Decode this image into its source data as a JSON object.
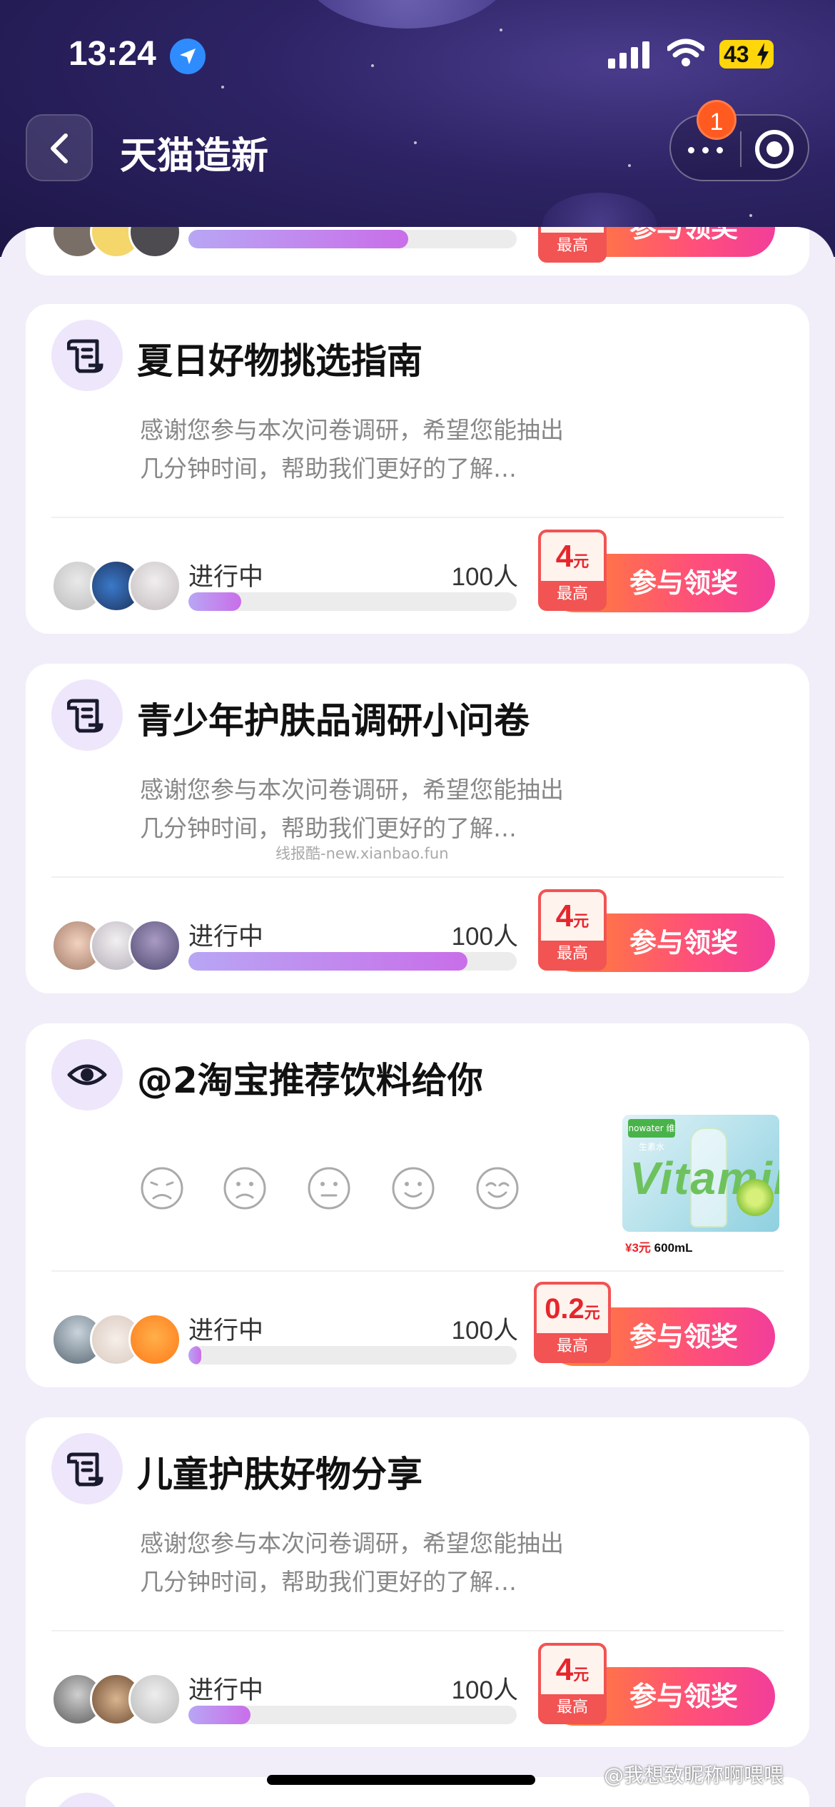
{
  "status_bar": {
    "time": "13:24",
    "battery": "43"
  },
  "nav": {
    "title": "天猫造新",
    "badge_count": "1"
  },
  "cards": [
    {
      "title": "夏日好物挑选指南",
      "desc": "感谢您参与本次问卷调研，希望您能抽出几分钟时间，帮助我们更好的了解…",
      "status": "进行中",
      "count": "100人",
      "progress": 0.16,
      "reward_amount": "4",
      "reward_unit": "元",
      "reward_label": "最高",
      "cta": "参与领奖",
      "icon": "scroll-icon"
    },
    {
      "title": "青少年护肤品调研小问卷",
      "desc": "感谢您参与本次问卷调研，希望您能抽出几分钟时间，帮助我们更好的了解…",
      "status": "进行中",
      "count": "100人",
      "progress": 0.85,
      "reward_amount": "4",
      "reward_unit": "元",
      "reward_label": "最高",
      "cta": "参与领奖",
      "icon": "scroll-icon"
    },
    {
      "title": "@2淘宝推荐饮料给你",
      "status": "进行中",
      "count": "100人",
      "progress": 0.04,
      "reward_amount": "0.2",
      "reward_unit": "元",
      "reward_label": "最高",
      "cta": "参与领奖",
      "icon": "eye-icon",
      "product": {
        "brand": "nowater 维生素水",
        "art_text": "Vitamin",
        "price": "¥3元",
        "volume": "600mL"
      }
    },
    {
      "title": "儿童护肤好物分享",
      "desc": "感谢您参与本次问卷调研，希望您能抽出几分钟时间，帮助我们更好的了解…",
      "status": "进行中",
      "count": "100人",
      "progress": 0.19,
      "reward_amount": "4",
      "reward_unit": "元",
      "reward_label": "最高",
      "cta": "参与领奖",
      "icon": "scroll-icon"
    }
  ],
  "partial_card": {
    "progress": 0.67,
    "reward_label": "最高",
    "cta": "参与领奖"
  },
  "watermark": "线报酷-new.xianbao.fun",
  "weibo_watermark": "@我想致昵称啊喂喂",
  "colors": {
    "accent": "#ff4f7a",
    "progress": "#c96ee9",
    "reward": "#e6262c"
  }
}
